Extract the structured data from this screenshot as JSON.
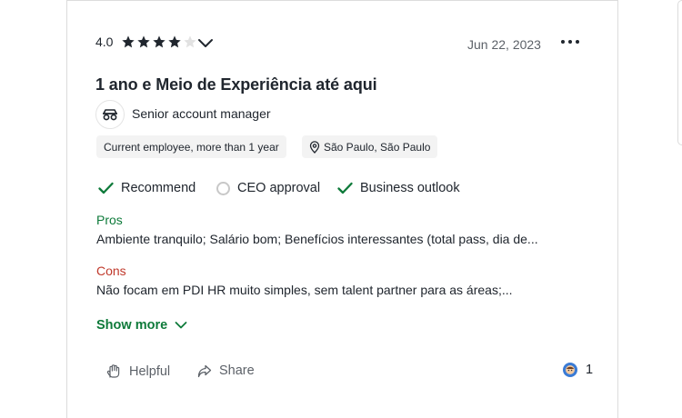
{
  "review": {
    "rating": "4.0",
    "stars_filled": 4,
    "stars_total": 5,
    "date": "Jun 22, 2023",
    "title": "1 ano e Meio de Experiência até aqui",
    "role": "Senior account manager",
    "employment": "Current employee, more than 1 year",
    "location": "São Paulo, São Paulo",
    "flags": {
      "recommend": {
        "label": "Recommend",
        "state": "positive"
      },
      "ceo": {
        "label": "CEO approval",
        "state": "neutral"
      },
      "outlook": {
        "label": "Business outlook",
        "state": "positive"
      }
    },
    "pros_label": "Pros",
    "pros_text": "Ambiente tranquilo; Salário bom; Benefícios interessantes (total pass, dia de...",
    "cons_label": "Cons",
    "cons_text": "Não focam em PDI HR muito simples, sem talent partner para as áreas;...",
    "show_more": "Show more",
    "helpful": "Helpful",
    "share": "Share",
    "reaction_count": "1"
  },
  "colors": {
    "accent_green": "#0e7a3a",
    "cons_red": "#c0392b",
    "text": "#20262e",
    "muted": "#5c6168",
    "chip_bg": "#f3f3f3"
  },
  "icons": [
    "star-icon",
    "chevron-down-icon",
    "more-icon",
    "employer-icon",
    "location-pin-icon",
    "check-icon",
    "empty-circle-icon",
    "helpful-hand-icon",
    "share-icon",
    "reaction-icon"
  ]
}
